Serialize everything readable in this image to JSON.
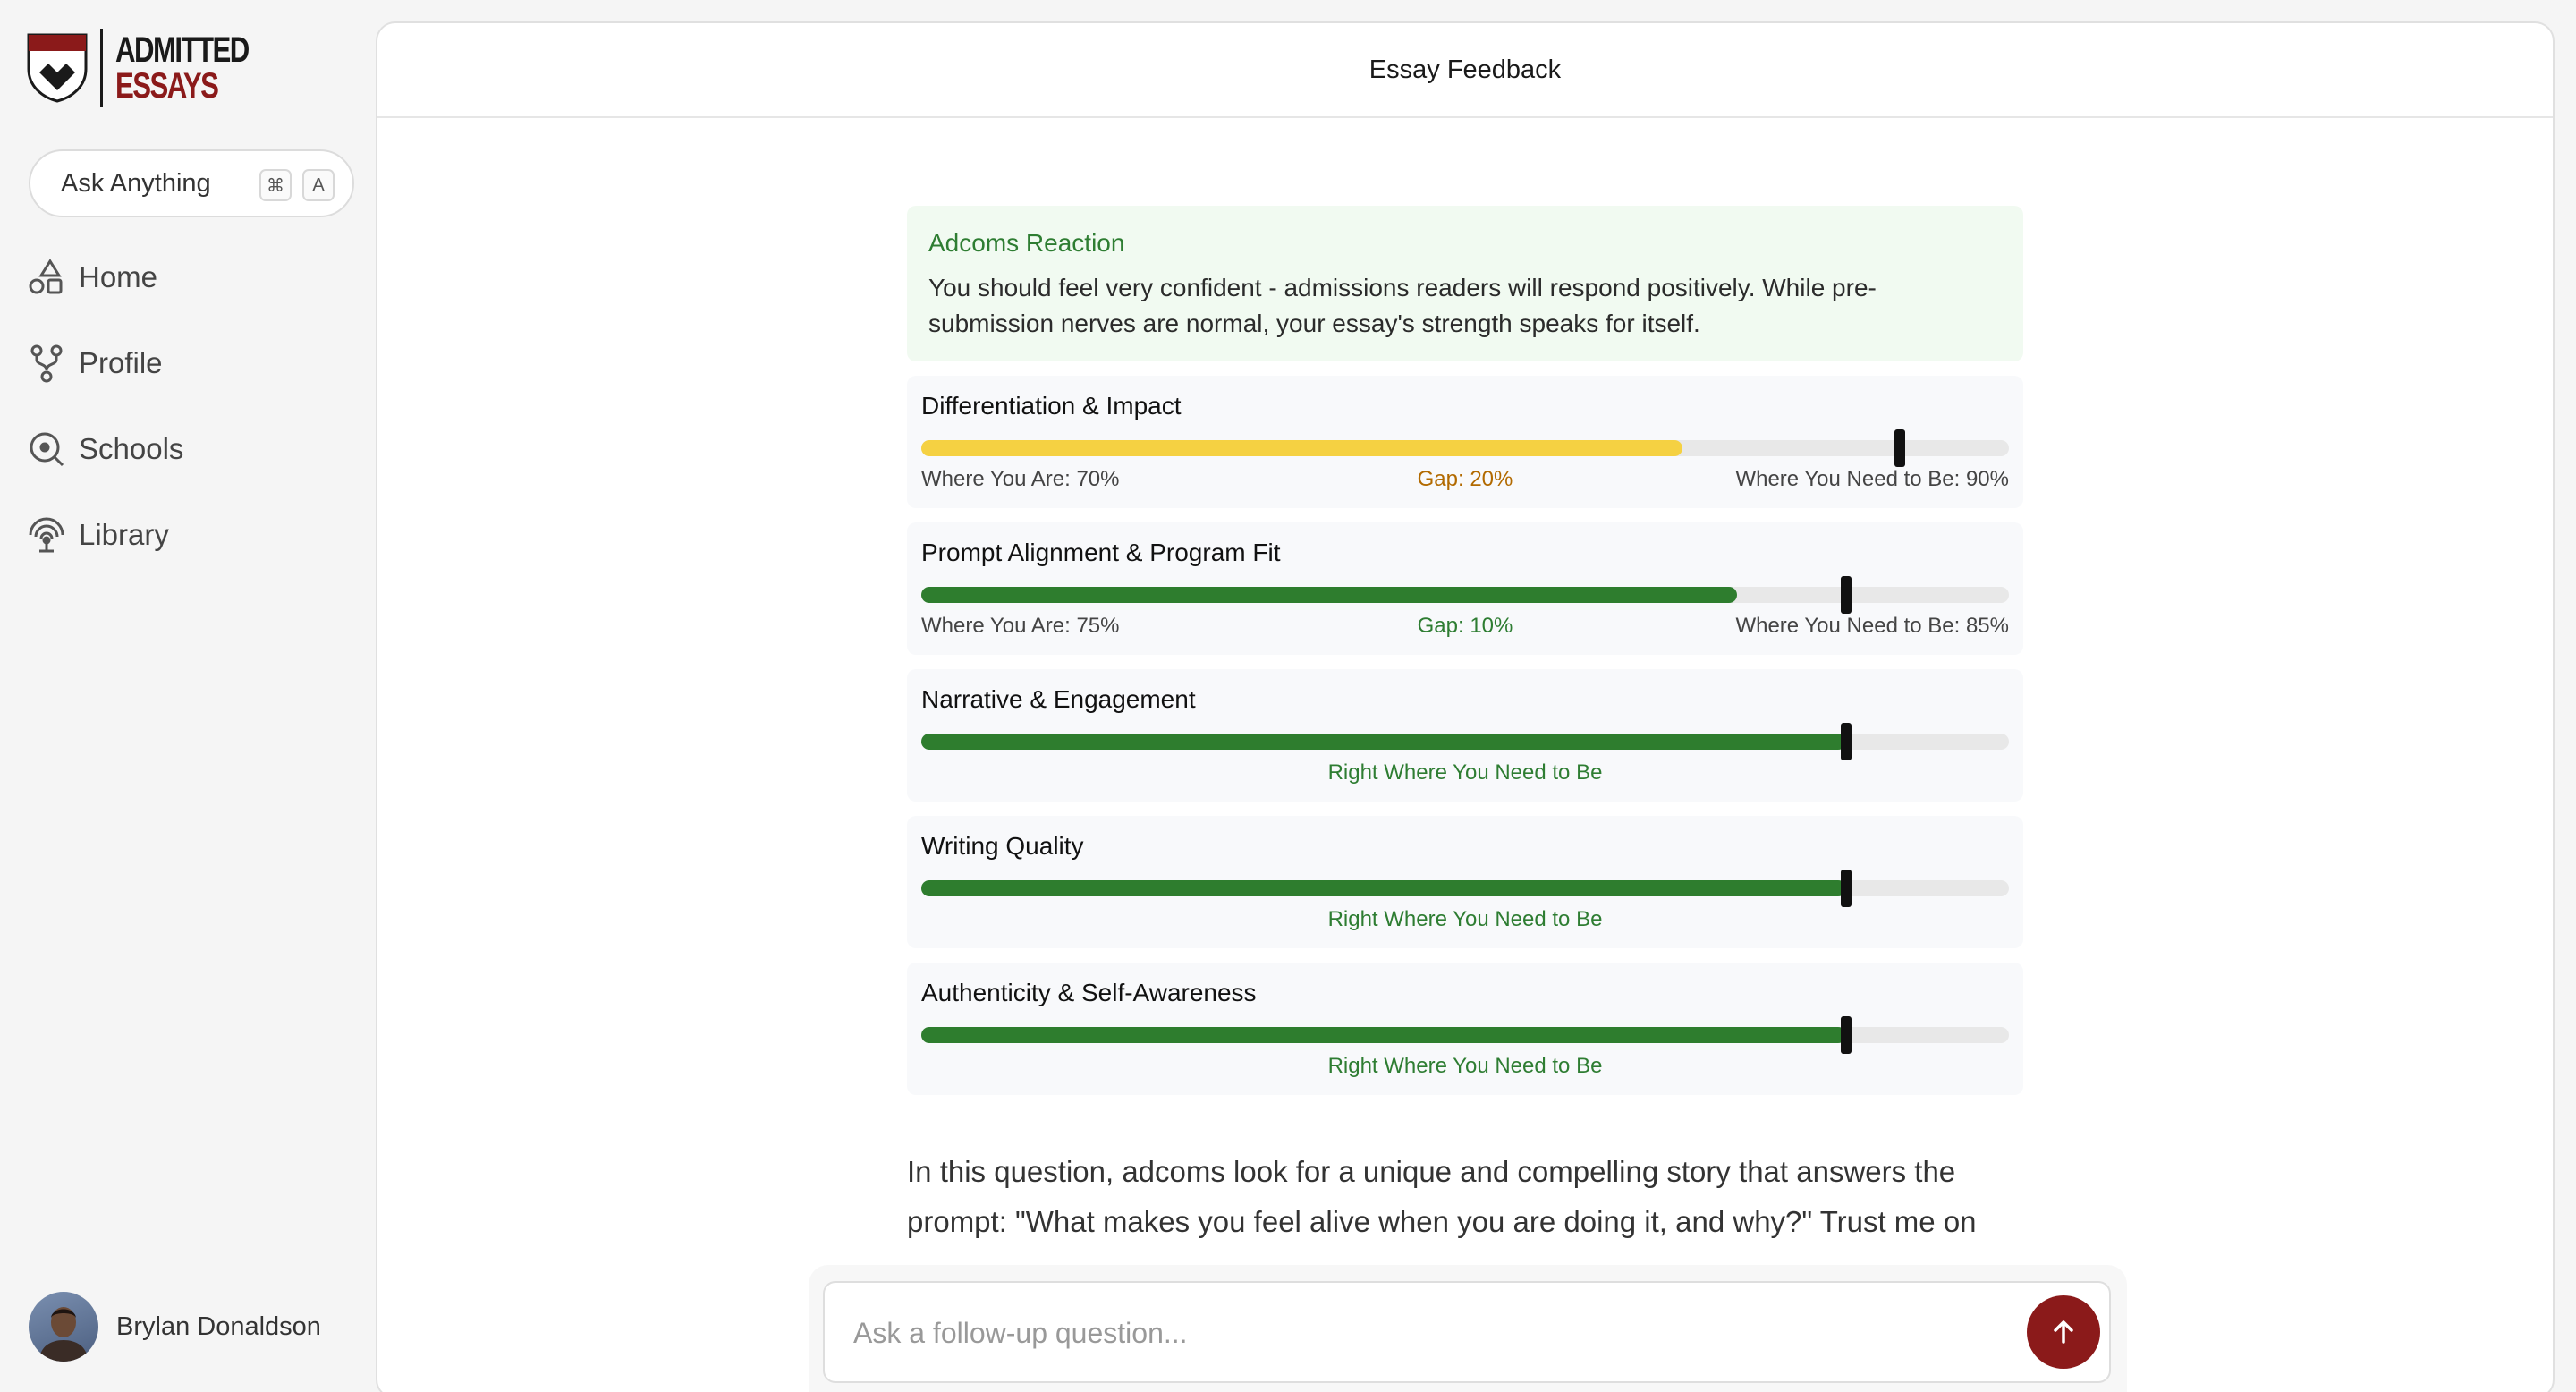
{
  "brand": {
    "line1": "ADMITTED",
    "line2": "ESSAYS"
  },
  "sidebar": {
    "ask_label": "Ask Anything",
    "kbd_cmd": "⌘",
    "kbd_key": "A",
    "items": [
      {
        "label": "Home",
        "icon": "home-shapes-icon"
      },
      {
        "label": "Profile",
        "icon": "branch-icon"
      },
      {
        "label": "Schools",
        "icon": "search-target-icon"
      },
      {
        "label": "Library",
        "icon": "signal-icon"
      }
    ],
    "user_name": "Brylan Donaldson"
  },
  "header": {
    "title": "Essay Feedback"
  },
  "reaction": {
    "title": "Adcoms Reaction",
    "text": "You should feel very confident - admissions readers will respond positively. While pre-submission nerves are normal, your essay's strength speaks for itself."
  },
  "metrics": [
    {
      "title": "Differentiation & Impact",
      "current": 70,
      "target": 90,
      "color": "#f5d142",
      "left_label": "Where You Are: 70%",
      "mid_label": "Gap: 20%",
      "mid_color": "#b26a00",
      "right_label": "Where You Need to Be: 90%",
      "ok_label": ""
    },
    {
      "title": "Prompt Alignment & Program Fit",
      "current": 75,
      "target": 85,
      "color": "#2e7d2e",
      "left_label": "Where You Are: 75%",
      "mid_label": "Gap: 10%",
      "mid_color": "#2e7d32",
      "right_label": "Where You Need to Be: 85%",
      "ok_label": ""
    },
    {
      "title": "Narrative & Engagement",
      "current": 85,
      "target": 85,
      "color": "#2e7d2e",
      "left_label": "",
      "mid_label": "",
      "mid_color": "#2e7d32",
      "right_label": "",
      "ok_label": "Right Where You Need to Be"
    },
    {
      "title": "Writing Quality",
      "current": 85,
      "target": 85,
      "color": "#2e7d2e",
      "left_label": "",
      "mid_label": "",
      "mid_color": "#2e7d32",
      "right_label": "",
      "ok_label": "Right Where You Need to Be"
    },
    {
      "title": "Authenticity & Self-Awareness",
      "current": 85,
      "target": 85,
      "color": "#2e7d2e",
      "left_label": "",
      "mid_label": "",
      "mid_color": "#2e7d32",
      "right_label": "",
      "ok_label": "Right Where You Need to Be"
    }
  ],
  "body_text": "In this question, adcoms look for a unique and compelling story that answers the prompt: \"What makes you feel alive when you are doing it, and why?\" Trust me on",
  "followup": {
    "placeholder": "Ask a follow-up question..."
  },
  "colors": {
    "accent": "#8b1a1a",
    "success": "#2e7d32"
  }
}
